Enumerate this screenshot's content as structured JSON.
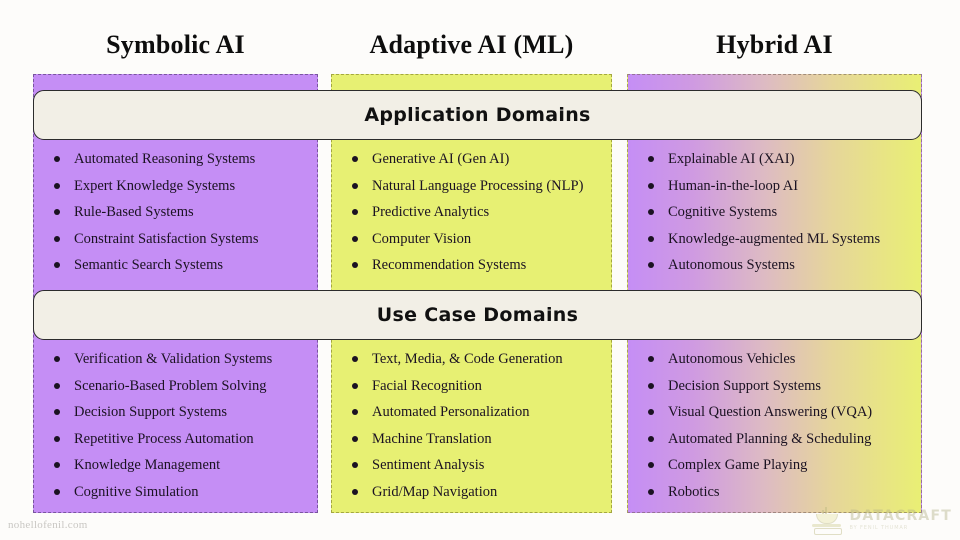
{
  "columns": [
    {
      "title": "Symbolic AI",
      "color": "#c58ef5"
    },
    {
      "title": "Adaptive AI (ML)",
      "color": "#e7f073"
    },
    {
      "title": "Hybrid AI",
      "color_start": "#c58ef5",
      "color_end": "#e9ef74"
    }
  ],
  "sections": [
    {
      "banner": "Application Domains",
      "lists": [
        [
          "Automated Reasoning Systems",
          "Expert Knowledge Systems",
          "Rule-Based Systems",
          "Constraint Satisfaction Systems",
          "Semantic Search Systems"
        ],
        [
          "Generative AI (Gen AI)",
          "Natural Language Processing (NLP)",
          "Predictive Analytics",
          "Computer Vision",
          "Recommendation Systems"
        ],
        [
          "Explainable AI (XAI)",
          "Human-in-the-loop AI",
          "Cognitive Systems",
          "Knowledge-augmented ML Systems",
          "Autonomous Systems"
        ]
      ]
    },
    {
      "banner": "Use Case Domains",
      "lists": [
        [
          "Verification & Validation Systems",
          "Scenario-Based Problem Solving",
          "Decision Support Systems",
          "Repetitive Process Automation",
          "Knowledge Management",
          "Cognitive Simulation"
        ],
        [
          "Text, Media, & Code Generation",
          "Facial Recognition",
          "Automated Personalization",
          "Machine Translation",
          "Sentiment Analysis",
          "Grid/Map Navigation"
        ],
        [
          "Autonomous Vehicles",
          "Decision Support Systems",
          "Visual Question Answering (VQA)",
          "Automated Planning & Scheduling",
          "Complex Game Playing",
          "Robotics"
        ]
      ]
    }
  ],
  "watermarks": {
    "site": "nohellofenil.com",
    "brand_name": "DATACRAFT",
    "brand_tagline": "BY FENIL THUMAR"
  }
}
